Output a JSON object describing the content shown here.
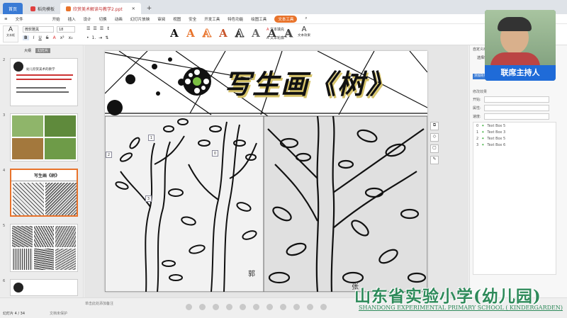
{
  "tabs": [
    {
      "label": "首页"
    },
    {
      "label": "稻壳模板"
    },
    {
      "label": "欣赏美术解读与教学2.ppt"
    }
  ],
  "menu": [
    "文件",
    "开始",
    "插入",
    "设计",
    "切换",
    "动画",
    "幻灯片放映",
    "审阅",
    "视图",
    "安全",
    "开发工具",
    "特色功能",
    "绘图工具",
    "文本工具"
  ],
  "toolbar": {
    "font_name": "微软雅黑",
    "font_size": "18",
    "textbox_label": "文本框",
    "text_fill": "文本填充",
    "text_outline": "文本轮廓",
    "text_effect": "文本效果",
    "style_letter": "A"
  },
  "left_panel": {
    "tab_outline": "大纲",
    "tab_slides": "幻灯片",
    "thumbs": [
      {
        "num": "2"
      },
      {
        "num": "3"
      },
      {
        "num": "4"
      },
      {
        "num": "5"
      },
      {
        "num": "6"
      }
    ],
    "thumb2_title": "幼儿欣赏美术的教学"
  },
  "slide": {
    "title": "写生画《树》",
    "badges": [
      "1",
      "2",
      "3",
      "0"
    ],
    "signature_left": "郭",
    "signature_right": "张"
  },
  "right_panel": {
    "header": "自定义动画",
    "select_label": "选择窗格",
    "add_effect": "添加效果",
    "modify_title": "修改效果",
    "start_label": "开始:",
    "property_label": "属性:",
    "speed_label": "速度:",
    "items": [
      {
        "idx": "0",
        "name": "Text Box 5"
      },
      {
        "idx": "1",
        "name": "Text Box 3"
      },
      {
        "idx": "2",
        "name": "Text Box 5"
      },
      {
        "idx": "3",
        "name": "Text Box 6"
      }
    ]
  },
  "presenter": {
    "label": "联席主持人"
  },
  "watermark": {
    "cn": "山东省实验小学(幼儿园)",
    "en": "SHANDONG EXPERIMENTAL PRIMARY SCHOOL ( KINDERGARDEN)"
  },
  "status": {
    "slide_info": "幻灯片 4 / 34",
    "notes_hint": "单击此处添加备注",
    "protect": "文档未保护"
  },
  "colors": {
    "accent": "#e8732b",
    "home_tab": "#3a7bd5"
  }
}
